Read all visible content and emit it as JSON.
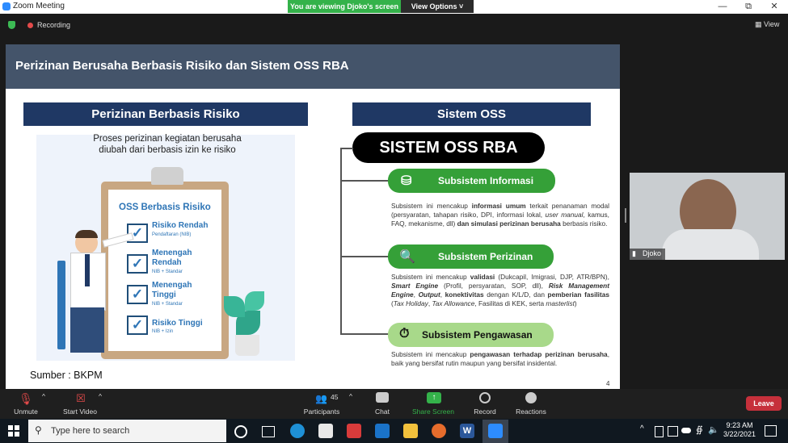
{
  "window": {
    "title": "Zoom Meeting"
  },
  "share_banner": {
    "text": "You are viewing Djoko's screen",
    "options": "View Options"
  },
  "meeting": {
    "recording_label": "Recording",
    "view_label": "View"
  },
  "slide": {
    "title": "Perizinan Berusaha Berbasis Risiko dan Sistem OSS RBA",
    "left_header": "Perizinan Berbasis Risiko",
    "intro_line1": "Proses perizinan kegiatan berusaha",
    "intro_line2": "diubah dari berbasis izin ke risiko",
    "clipboard_title": "OSS Berbasis Risiko",
    "items": [
      {
        "l1": "Risiko Rendah",
        "l2": "",
        "sub": "Pendaftaran (NIB)"
      },
      {
        "l1": "Menengah",
        "l2": "Rendah",
        "sub": "NIB + Standar"
      },
      {
        "l1": "Menengah",
        "l2": "Tinggi",
        "sub": "NIB + Standar"
      },
      {
        "l1": "Risiko Tinggi",
        "l2": "",
        "sub": "NIB + Izin"
      }
    ],
    "source": "Sumber : BKPM",
    "right_header": "Sistem OSS",
    "oss_title": "SISTEM OSS RBA",
    "subsystems": [
      {
        "name": "Subsistem Informasi",
        "text": "Subsistem ini mencakup informasi umum terkait penanaman modal (persyaratan, tahapan risiko, DPI, informasi lokal, user manual, kamus, FAQ, mekanisme, dll) dan simulasi perizinan berusaha berbasis risiko."
      },
      {
        "name": "Subsistem Perizinan",
        "text": "Subsistem ini mencakup validasi (Dukcapil, Imigrasi, DJP, ATR/BPN), Smart Engine (Profil, persyaratan, SOP, dll), Risk Management Engine, Output, konektivitas dengan K/L/D, dan pemberian fasilitas (Tax Holiday, Tax Allowance, Fasilitas di KEK, serta masterlist)"
      },
      {
        "name": "Subsistem Pengawasan",
        "text": "Subsistem ini mencakup pengawasan terhadap perizinan berusaha, baik yang bersifat rutin maupun yang bersifat insidental."
      }
    ],
    "page_number": "4"
  },
  "video": {
    "name": "Djoko"
  },
  "toolbar": {
    "unmute": "Unmute",
    "start_video": "Start Video",
    "participants": "Participants",
    "participants_count": "45",
    "chat": "Chat",
    "share": "Share Screen",
    "record": "Record",
    "reactions": "Reactions",
    "leave": "Leave"
  },
  "taskbar": {
    "search_placeholder": "Type here to search",
    "time": "9:23 AM",
    "date": "3/22/2021"
  },
  "colors": {
    "slide_header": "#44546a",
    "navy": "#1f3864",
    "green": "#35a038",
    "share_green": "#34b24a",
    "leave_red": "#c6303b"
  }
}
